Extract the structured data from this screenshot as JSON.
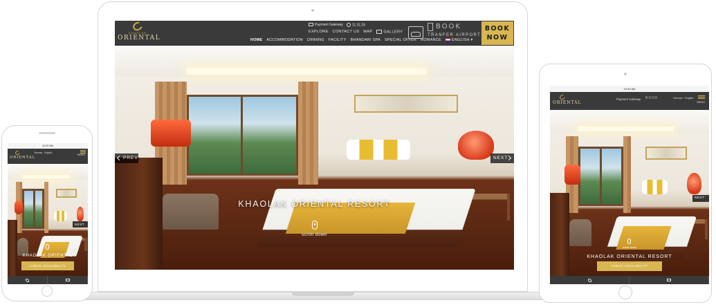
{
  "laptop": {
    "logo_small": "KHAOLAK",
    "logo_name": "ORIENTAL",
    "payment_gateway": "Payment Gateway",
    "clock": "11:31:24",
    "explore": "EXPLORE",
    "contact": "CONTACT US",
    "map": "MAP",
    "gallery": "GALLERY",
    "transfer_word": "BOOK",
    "transfer_sub": "TRANFER AIRPORT",
    "book_now_line1": "BOOK",
    "book_now_line2": "NOW",
    "nav": [
      "HOME",
      "ACCOMMODATION",
      "DINNING",
      "FACILITY",
      "BHANDARI SPA",
      "SPECIAL OFFER",
      "ROMANCE"
    ],
    "language": "ENGLISH",
    "prev": "PREV",
    "next": "NEXT",
    "hero_title": "KHAOLAK ORIENTAL RESORT",
    "scroll_label": "scroll down"
  },
  "phone": {
    "status_time": "10:30 AM",
    "logo_name": "ORIENTAL",
    "lang": "German",
    "lang2": "English",
    "menu": "MENU",
    "next": "NEXT",
    "title": "KHAOLAK ORIENTAL",
    "check": "CHECK AVAILABILITY"
  },
  "tablet": {
    "status_time": "10:30 AM",
    "logo_name": "ORIENTAL",
    "payment_gateway": "Payment Gateway",
    "book": "BOOK",
    "lang": "German",
    "lang2": "English",
    "menu": "MENU",
    "next": "NEXT",
    "scroll_label": "scroll down",
    "title": "KHAOLAK ORIENTAL RESORT",
    "check": "CHECK AVAILABILITY"
  },
  "colors": {
    "header": "#3a3a3a",
    "accent_gold": "#d8b651",
    "logo_gold": "#c9a84f"
  }
}
